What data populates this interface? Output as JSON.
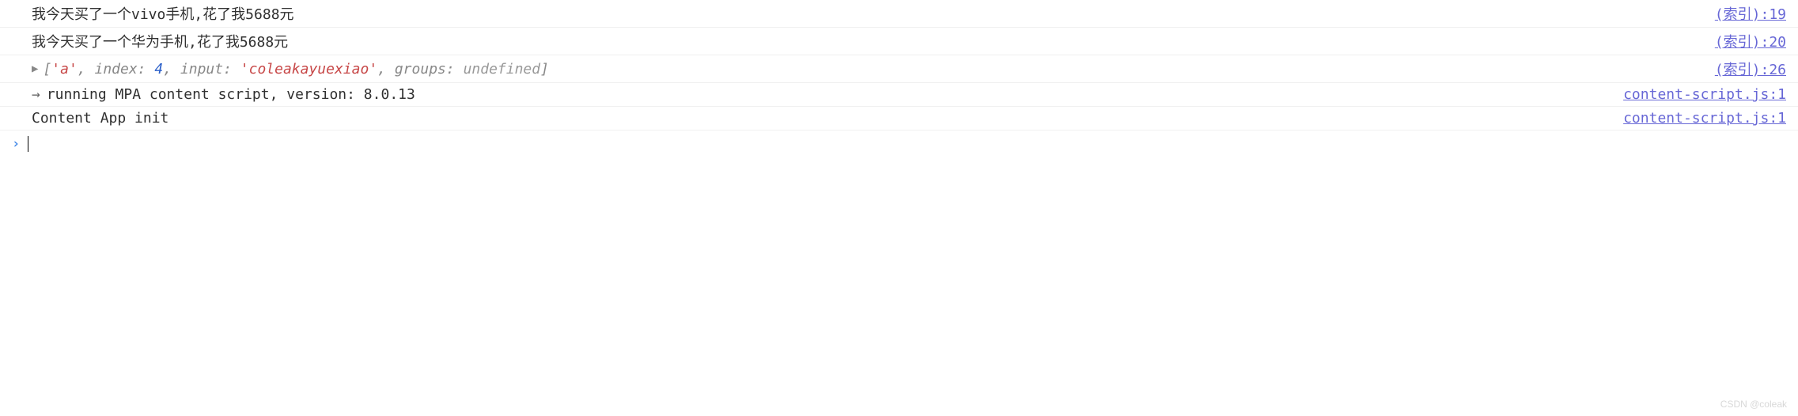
{
  "rows": [
    {
      "message": "我今天买了一个vivo手机,花了我5688元",
      "source_label": "(索引):19"
    },
    {
      "message": "我今天买了一个华为手机,花了我5688元",
      "source_label": "(索引):20"
    },
    {
      "array_preview": {
        "value": "'a'",
        "index": "4",
        "input": "'coleakayuexiao'",
        "groups": "undefined"
      },
      "source_label": "(索引):26"
    },
    {
      "prefix": "→",
      "message": "running MPA content script, version: 8.0.13",
      "source_label": "content-script.js:1"
    },
    {
      "message": "Content App init",
      "source_label": "content-script.js:1"
    }
  ],
  "labels": {
    "index_key": "index",
    "input_key": "input",
    "groups_key": "groups"
  },
  "watermark": "CSDN @coleak"
}
